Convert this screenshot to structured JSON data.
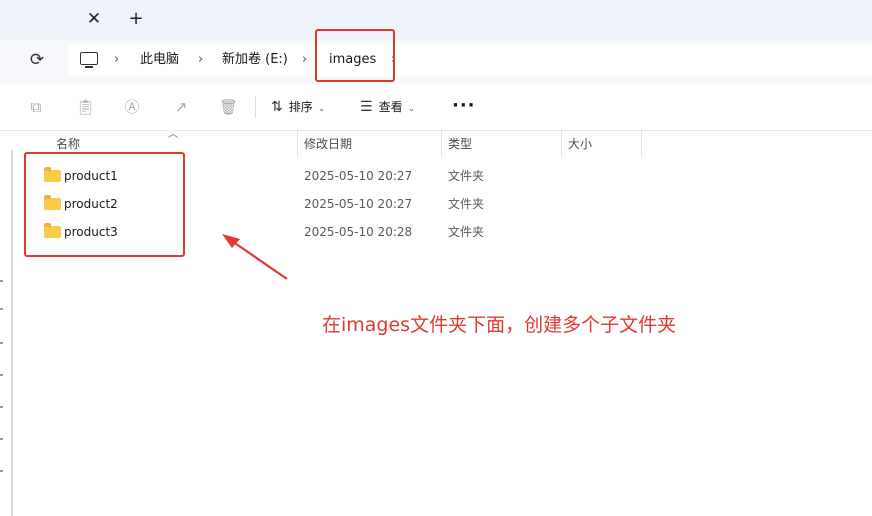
{
  "tabbar": {
    "close_glyph": "✕",
    "new_glyph": "+"
  },
  "address": {
    "refresh_icon": "refresh-icon",
    "crumbs": [
      "此电脑",
      "新加卷 (E:)",
      "images"
    ],
    "separator": "›"
  },
  "toolbar": {
    "disabled_icons": [
      "copy-icon",
      "paste-icon",
      "rename-icon",
      "share-icon",
      "delete-icon"
    ],
    "sort_label": "排序",
    "view_label": "查看",
    "more_label": "···"
  },
  "columns": {
    "name": "名称",
    "modified": "修改日期",
    "type": "类型",
    "size": "大小"
  },
  "files": [
    {
      "name": "product1",
      "modified": "2025-05-10 20:27",
      "type": "文件夹"
    },
    {
      "name": "product2",
      "modified": "2025-05-10 20:27",
      "type": "文件夹"
    },
    {
      "name": "product3",
      "modified": "2025-05-10 20:28",
      "type": "文件夹"
    }
  ],
  "annotation": {
    "text": "在images文件夹下面，创建多个子文件夹",
    "color": "#e03a2f"
  }
}
